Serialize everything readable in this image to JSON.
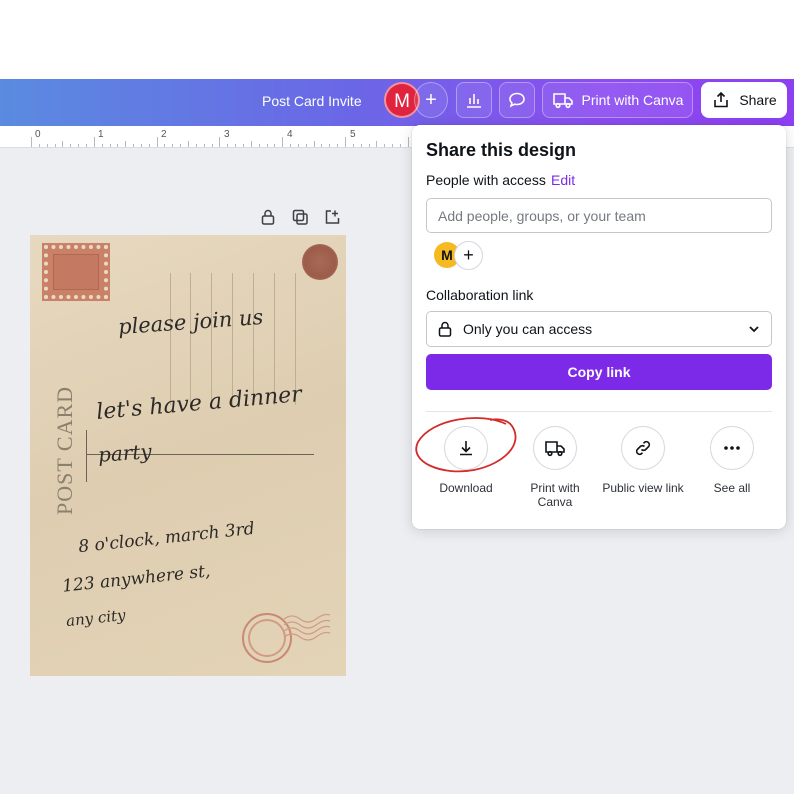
{
  "topbar": {
    "doc_title": "Post Card Invite",
    "avatar_initial": "M",
    "add_label": "+",
    "print_label": "Print with Canva",
    "share_label": "Share",
    "icons": [
      "plus-icon",
      "stats-icon",
      "comment-icon",
      "truck-icon",
      "share-upload-icon"
    ]
  },
  "ruler": {
    "marks": [
      "0",
      "1",
      "2",
      "3",
      "4",
      "5"
    ]
  },
  "page_tools": {
    "icons": [
      "lock-icon",
      "duplicate-icon",
      "add-page-icon"
    ]
  },
  "postcard": {
    "side_text": "POST CARD",
    "lines": [
      "please join us",
      "let's have a dinner",
      "party",
      "8 o'clock, march 3rd",
      "123 anywhere st,",
      "any city"
    ]
  },
  "share_panel": {
    "title": "Share this design",
    "people_label": "People with access",
    "edit_label": "Edit",
    "input_placeholder": "Add people, groups, or your team",
    "member_initial": "M",
    "add_member_label": "+",
    "collab_label": "Collaboration link",
    "access_value": "Only you can access",
    "copy_label": "Copy link",
    "actions": [
      {
        "label": "Download",
        "icon": "download-icon"
      },
      {
        "label": "Print with Canva",
        "icon": "truck-icon"
      },
      {
        "label": "Public view link",
        "icon": "link-icon"
      },
      {
        "label": "See all",
        "icon": "more-icon"
      }
    ]
  },
  "colors": {
    "accent": "#7d2ae8",
    "avatar_red": "#e0243f",
    "avatar_yellow": "#f5b922",
    "annotation_red": "#d42a2a"
  }
}
